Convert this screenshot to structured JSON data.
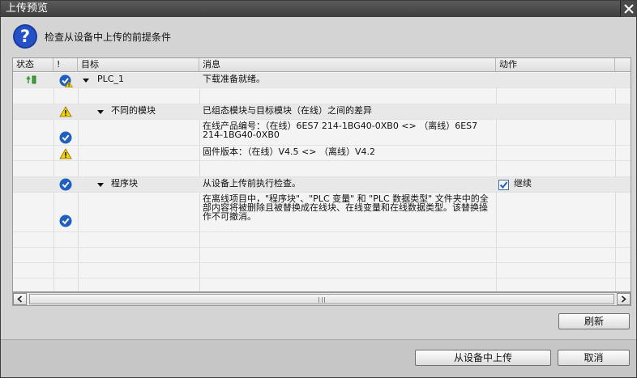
{
  "window": {
    "title": "上传预览"
  },
  "header": {
    "text": "检查从设备中上传的前提条件"
  },
  "columns": {
    "status": "状态",
    "bang": "!",
    "target": "目标",
    "message": "消息",
    "action": "动作"
  },
  "rows": [
    {
      "target": "PLC_1",
      "message": "下载准备就绪。"
    },
    {
      "target": "不同的模块",
      "message": "已组态模块与目标模块（在线）之间的差异"
    },
    {
      "message": "在线产品编号：（在线）6ES7 214-1BG40-0XB0 <> （离线）6ES7 214-1BG40-0XB0"
    },
    {
      "message": "固件版本：（在线）V4.5 <> （离线）V4.2"
    },
    {
      "target": "程序块",
      "message": "从设备上传前执行检查。",
      "action": "继续"
    },
    {
      "message": "在离线项目中，\"程序块\"、\"PLC 变量\" 和 \"PLC 数据类型\" 文件夹中的全部内容将被删除且被替换成在线块、在线变量和在线数据类型。该替换操作不可撤消。"
    }
  ],
  "buttons": {
    "refresh": "刷新",
    "upload": "从设备中上传",
    "cancel": "取消"
  },
  "colors": {
    "check_blue": "#1f5fbf",
    "warn_yellow": "#f5d000",
    "accent_green": "#3aa43a"
  }
}
